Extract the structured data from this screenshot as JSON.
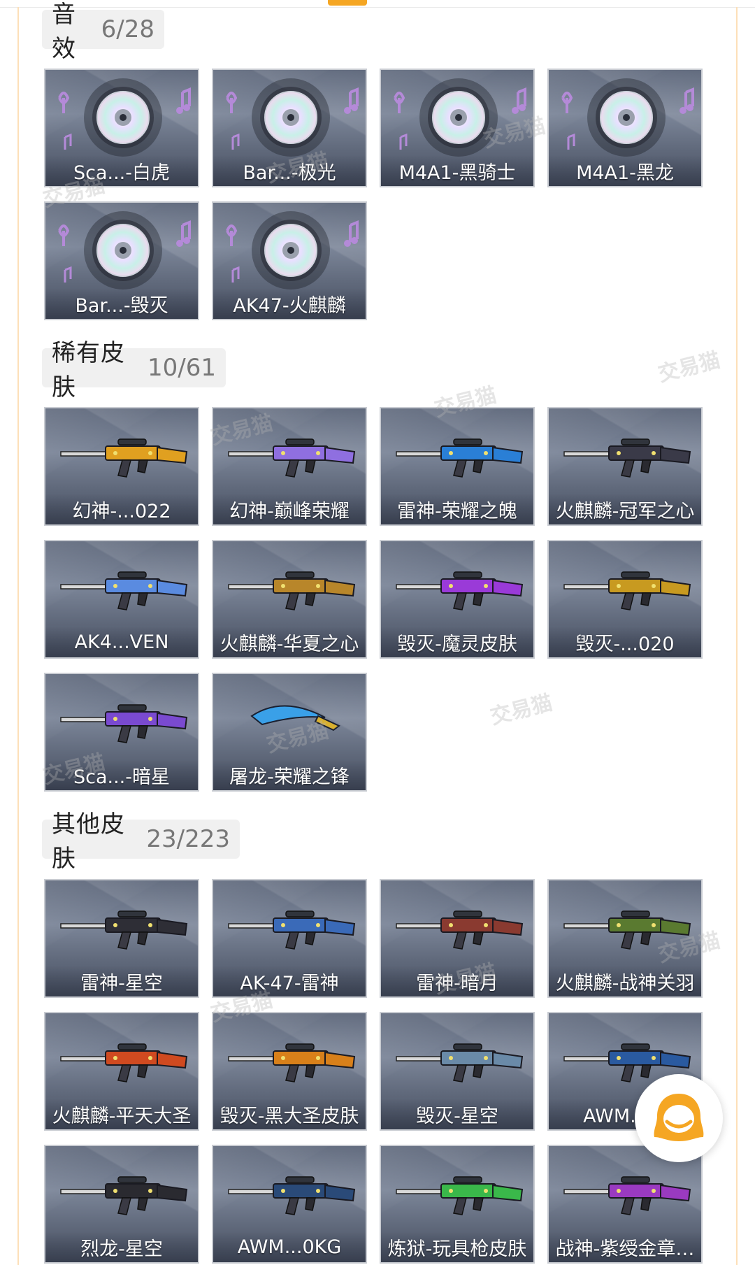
{
  "watermark": "交易猫",
  "sections": [
    {
      "title": "音效",
      "count": "6/28",
      "items": [
        {
          "label": "Sca...-白虎",
          "icon": "music-disc-icon"
        },
        {
          "label": "Bar...-极光",
          "icon": "music-disc-icon"
        },
        {
          "label": "M4A1-黑骑士",
          "icon": "music-disc-icon"
        },
        {
          "label": "M4A1-黑龙",
          "icon": "music-disc-icon"
        },
        {
          "label": "Bar...-毁灭",
          "icon": "music-disc-icon"
        },
        {
          "label": "AK47-火麒麟",
          "icon": "music-disc-icon"
        }
      ]
    },
    {
      "title": "稀有皮肤",
      "count": "10/61",
      "items": [
        {
          "label": "幻神-...022",
          "icon": "rifle-skin-icon",
          "color": "#e0a020"
        },
        {
          "label": "幻神-巅峰荣耀",
          "icon": "rifle-skin-icon",
          "color": "#8f6fe0"
        },
        {
          "label": "雷神-荣耀之魄",
          "icon": "rifle-skin-icon",
          "color": "#2a7fd6"
        },
        {
          "label": "火麒麟-冠军之心",
          "icon": "rifle-skin-icon",
          "color": "#3a3a48"
        },
        {
          "label": "AK4...VEN",
          "icon": "rifle-skin-icon",
          "color": "#5a8be0"
        },
        {
          "label": "火麒麟-华夏之心",
          "icon": "rifle-skin-icon",
          "color": "#b8862a"
        },
        {
          "label": "毁灭-魔灵皮肤",
          "icon": "rifle-skin-icon",
          "color": "#9a3ad8"
        },
        {
          "label": "毁灭-...020",
          "icon": "rifle-skin-icon",
          "color": "#c89a20"
        },
        {
          "label": "Sca...-暗星",
          "icon": "rifle-skin-icon",
          "color": "#7a4ad0"
        },
        {
          "label": "屠龙-荣耀之锋",
          "icon": "blade-skin-icon",
          "color": "#3aa0e8"
        }
      ]
    },
    {
      "title": "其他皮肤",
      "count": "23/223",
      "items": [
        {
          "label": "雷神-星空",
          "icon": "rifle-skin-icon",
          "color": "#2e2e36"
        },
        {
          "label": "AK-47-雷神",
          "icon": "rifle-skin-icon",
          "color": "#3a6ab8"
        },
        {
          "label": "雷神-暗月",
          "icon": "rifle-skin-icon",
          "color": "#8a3a30"
        },
        {
          "label": "火麒麟-战神关羽",
          "icon": "rifle-skin-icon",
          "color": "#5a7a30"
        },
        {
          "label": "火麒麟-平天大圣",
          "icon": "rifle-skin-icon",
          "color": "#d04a20"
        },
        {
          "label": "毁灭-黑大圣皮肤",
          "icon": "rifle-skin-icon",
          "color": "#d8801a"
        },
        {
          "label": "毁灭-星空",
          "icon": "rifle-skin-icon",
          "color": "#6a8aa8"
        },
        {
          "label": "AWM...毒",
          "icon": "rifle-skin-icon",
          "color": "#2a5aa0"
        },
        {
          "label": "烈龙-星空",
          "icon": "rifle-skin-icon",
          "color": "#2a2a30"
        },
        {
          "label": "AWM...0KG",
          "icon": "rifle-skin-icon",
          "color": "#2a4a78"
        },
        {
          "label": "炼狱-玩具枪皮肤",
          "icon": "rifle-skin-icon",
          "color": "#3ab84a"
        },
        {
          "label": "战神-紫绶金章…",
          "icon": "rifle-skin-icon",
          "color": "#9a3ac0"
        }
      ]
    }
  ],
  "float_button": {
    "icon": "chat-assistant-icon",
    "color": "#f5a623"
  }
}
